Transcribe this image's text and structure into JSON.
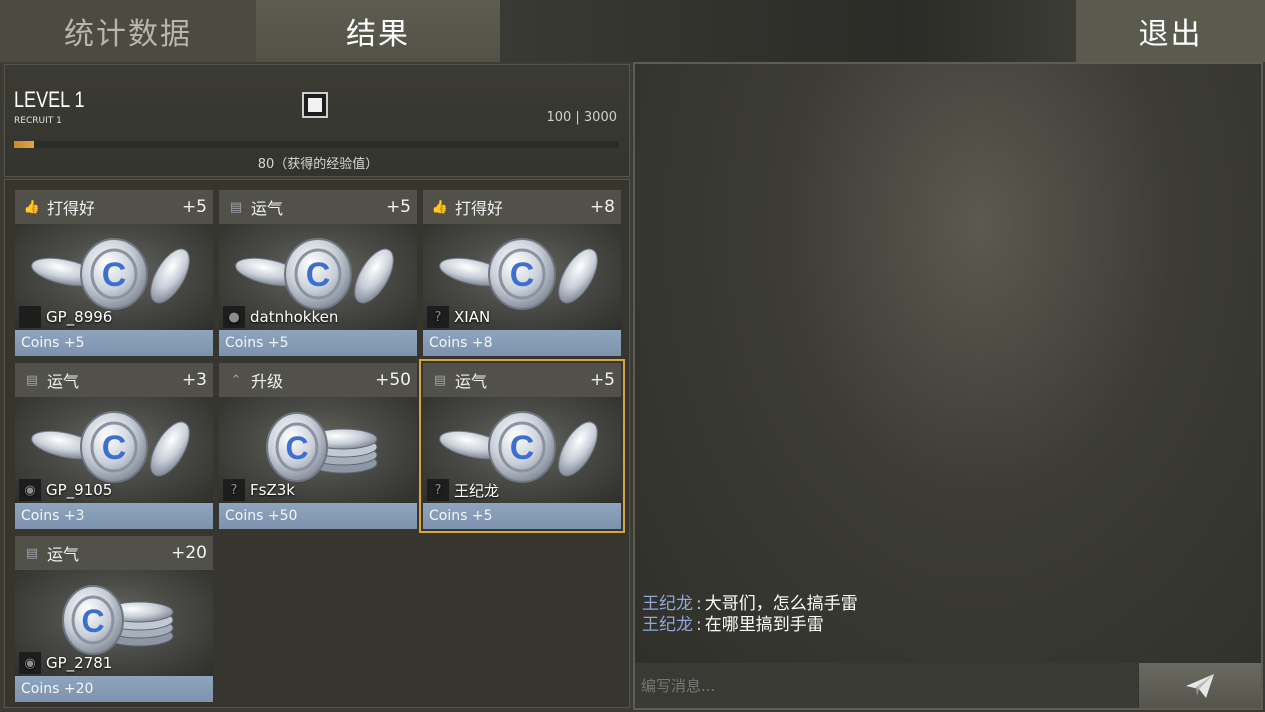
{
  "tabs": {
    "stats": "统计数据",
    "results": "结果",
    "exit": "退出"
  },
  "level": {
    "title": "LEVEL 1",
    "rank": "RECRUIT 1",
    "xp_current": 100,
    "xp_max": 3000,
    "xp_label": "100 | 3000",
    "xp_progress_fraction": 0.033,
    "xp_gained": "80（获得的经验值）"
  },
  "rewards": [
    {
      "category": "打得好",
      "icon": "thumbs-up-icon",
      "amount": "+5",
      "player": "GP_8996",
      "avatar": "black-avatar",
      "coins": "Coins +5",
      "coin_art": "coin-spread",
      "selected": false
    },
    {
      "category": "运气",
      "icon": "cash-icon",
      "amount": "+5",
      "player": "datnhokken",
      "avatar": "soldier-avatar",
      "coins": "Coins +5",
      "coin_art": "coin-spread",
      "selected": false
    },
    {
      "category": "打得好",
      "icon": "thumbs-up-icon",
      "amount": "+8",
      "player": "XIAN",
      "avatar": "unknown-avatar",
      "coins": "Coins +8",
      "coin_art": "coin-spread",
      "selected": false
    },
    {
      "category": "运气",
      "icon": "cash-icon",
      "amount": "+3",
      "player": "GP_9105",
      "avatar": "panda-avatar",
      "coins": "Coins +3",
      "coin_art": "coin-spread",
      "selected": false
    },
    {
      "category": "升级",
      "icon": "rank-up-icon",
      "amount": "+50",
      "player": "FsZ3k",
      "avatar": "unknown-avatar",
      "coins": "Coins +50",
      "coin_art": "coin-stack",
      "selected": false
    },
    {
      "category": "运气",
      "icon": "cash-icon",
      "amount": "+5",
      "player": "王纪龙",
      "avatar": "unknown-avatar",
      "coins": "Coins +5",
      "coin_art": "coin-spread",
      "selected": true
    },
    {
      "category": "运气",
      "icon": "cash-icon",
      "amount": "+20",
      "player": "GP_2781",
      "avatar": "owl-avatar",
      "coins": "Coins +20",
      "coin_art": "coin-stack",
      "selected": false
    }
  ],
  "chat": {
    "messages": [
      {
        "name": "王纪龙",
        "sep": ":",
        "text": "大哥们，怎么搞手雷"
      },
      {
        "name": "王纪龙",
        "sep": ":",
        "text": "在哪里搞到手雷"
      }
    ],
    "input_placeholder": "编写消息...",
    "send_icon": "paper-plane-icon"
  },
  "colors": {
    "accent_selected": "#d6a445",
    "xp_fill": "#d99a3a",
    "coins_footer": "#8599b3",
    "chat_name": "#8fa8d8"
  }
}
